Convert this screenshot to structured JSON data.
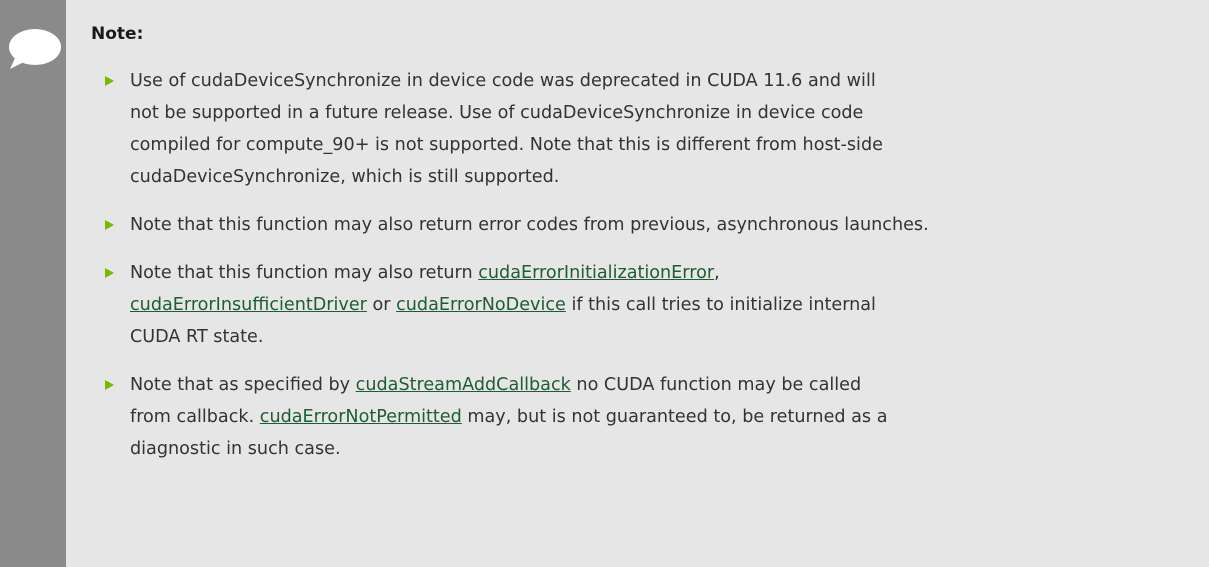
{
  "note": {
    "title": "Note:",
    "icon": "speech-bubble-icon",
    "accent_color": "#76b900",
    "rail_color": "#8a8a8a",
    "background_color": "#e6e6e6",
    "link_color": "#1e5c32",
    "items": [
      {
        "lines": [
          "Use of cudaDeviceSynchronize in device code was deprecated in CUDA 11.6 and will",
          "not be supported in a future release. Use of cudaDeviceSynchronize in device code",
          "compiled for compute_90+ is not supported. Note that this is different from host-side",
          "cudaDeviceSynchronize, which is still supported."
        ]
      },
      {
        "lines": [
          "Note that this function may also return error codes from previous, asynchronous launches."
        ]
      },
      {
        "text_1": "Note that this function may also return ",
        "link_1": "cudaErrorInitializationError",
        "text_2": ",",
        "link_2": "cudaErrorInsufficientDriver",
        "text_3": " or ",
        "link_3": "cudaErrorNoDevice",
        "text_4": " if this call tries to initialize internal",
        "text_5": "CUDA RT state."
      },
      {
        "text_1": "Note that as specified by ",
        "link_1": "cudaStreamAddCallback",
        "text_2": " no CUDA function may be called",
        "text_3": "from callback. ",
        "link_2": "cudaErrorNotPermitted",
        "text_4": " may, but is not guaranteed to, be returned as a",
        "text_5": "diagnostic in such case."
      }
    ]
  }
}
